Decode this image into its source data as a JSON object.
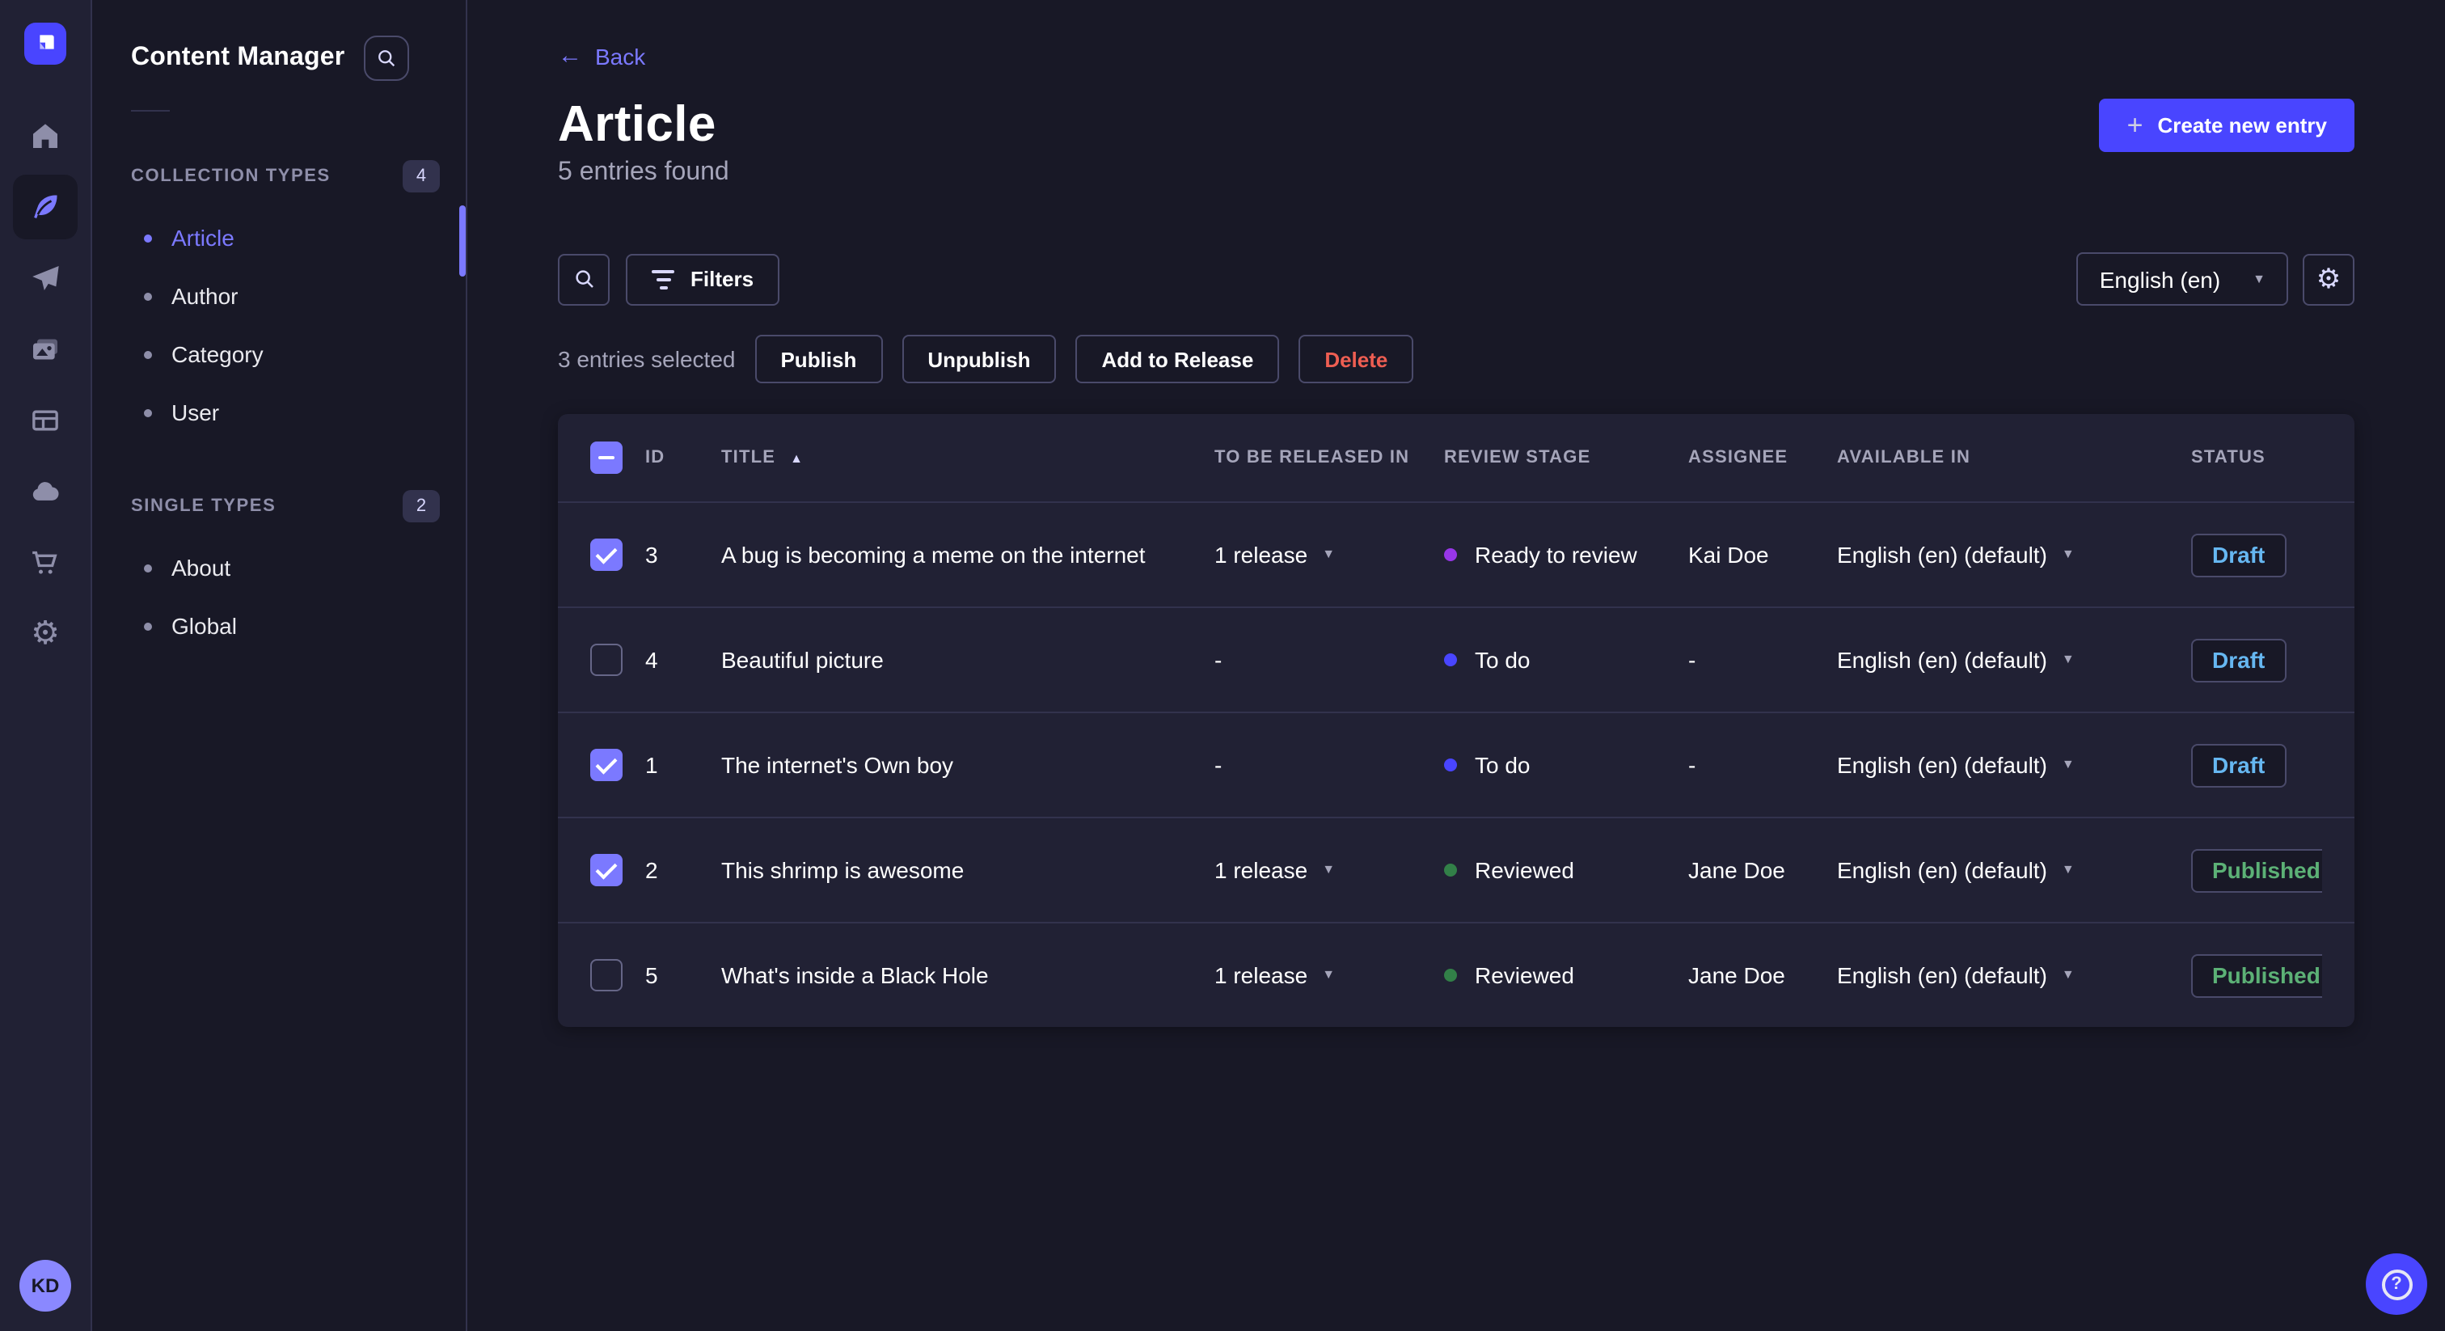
{
  "icons": {
    "back_arrow": "←",
    "plus": "+",
    "sort_asc": "▲",
    "caret_down": "▼",
    "gear": "⚙",
    "question": "?"
  },
  "rail": {
    "avatar_initials": "KD"
  },
  "sidebar": {
    "title": "Content Manager",
    "sections": [
      {
        "label": "COLLECTION TYPES",
        "count": "4",
        "items": [
          {
            "label": "Article",
            "active": true
          },
          {
            "label": "Author",
            "active": false
          },
          {
            "label": "Category",
            "active": false
          },
          {
            "label": "User",
            "active": false
          }
        ]
      },
      {
        "label": "SINGLE TYPES",
        "count": "2",
        "items": [
          {
            "label": "About",
            "active": false
          },
          {
            "label": "Global",
            "active": false
          }
        ]
      }
    ]
  },
  "header": {
    "back": "Back",
    "title": "Article",
    "subtitle": "5 entries found",
    "create_button": "Create new entry"
  },
  "toolbar": {
    "filters": "Filters",
    "locale": "English (en)"
  },
  "selection": {
    "text": "3 entries selected",
    "publish": "Publish",
    "unpublish": "Unpublish",
    "add_to_release": "Add to Release",
    "delete": "Delete"
  },
  "table": {
    "select_all": "indeterminate",
    "sort_column": "TITLE",
    "sort_direction": "asc",
    "columns": [
      "ID",
      "TITLE",
      "TO BE RELEASED IN",
      "REVIEW STAGE",
      "ASSIGNEE",
      "AVAILABLE IN",
      "STATUS"
    ],
    "rows": [
      {
        "checked": true,
        "id": "3",
        "title": "A bug is becoming a meme on the internet",
        "release": "1 release",
        "stage": "Ready to review",
        "stage_color": "#9736e8",
        "assignee": "Kai Doe",
        "locale": "English (en) (default)",
        "status": "Draft"
      },
      {
        "checked": false,
        "id": "4",
        "title": "Beautiful picture",
        "release": "-",
        "stage": "To do",
        "stage_color": "#4945ff",
        "assignee": "-",
        "locale": "English (en) (default)",
        "status": "Draft"
      },
      {
        "checked": true,
        "id": "1",
        "title": "The internet's Own boy",
        "release": "-",
        "stage": "To do",
        "stage_color": "#4945ff",
        "assignee": "-",
        "locale": "English (en) (default)",
        "status": "Draft"
      },
      {
        "checked": true,
        "id": "2",
        "title": "This shrimp is awesome",
        "release": "1 release",
        "stage": "Reviewed",
        "stage_color": "#328048",
        "assignee": "Jane Doe",
        "locale": "English (en) (default)",
        "status": "Published"
      },
      {
        "checked": false,
        "id": "5",
        "title": "What's inside a Black Hole",
        "release": "1 release",
        "stage": "Reviewed",
        "stage_color": "#328048",
        "assignee": "Jane Doe",
        "locale": "English (en) (default)",
        "status": "Published"
      }
    ]
  },
  "colors": {
    "primary": "#4945ff",
    "link": "#7b79ff",
    "draft": "#66b7f1",
    "published": "#5cb176",
    "delete": "#ee5e52"
  }
}
